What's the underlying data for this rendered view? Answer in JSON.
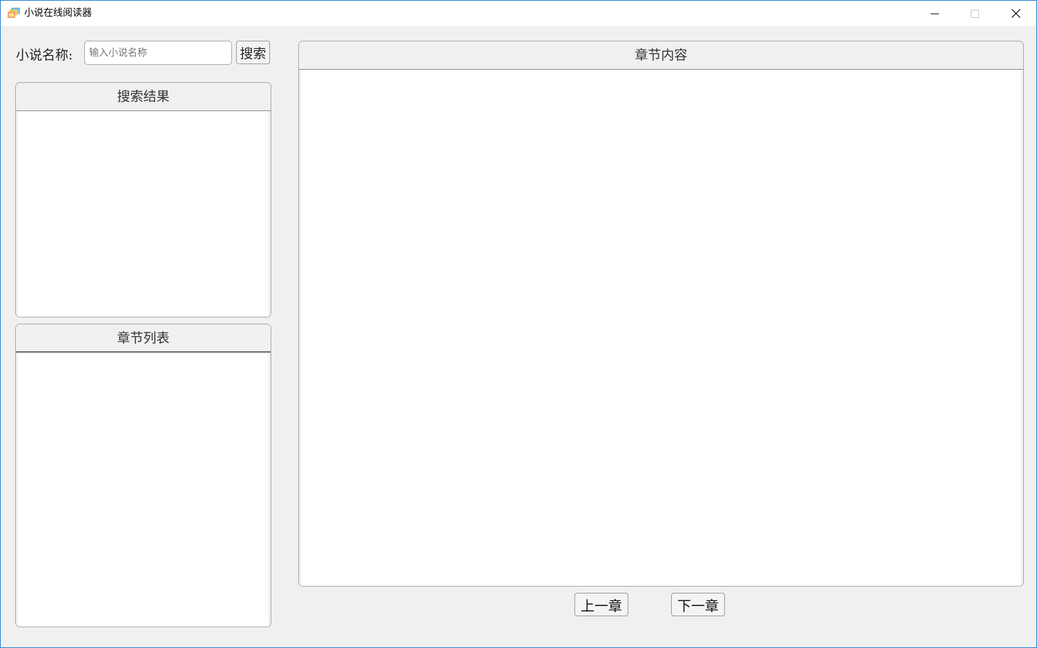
{
  "window": {
    "title": "小说在线阅读器"
  },
  "search": {
    "label": "小说名称:",
    "input_value": "",
    "placeholder": "输入小说名称",
    "button_label": "搜索"
  },
  "panels": {
    "search_results_title": "搜索结果",
    "chapter_list_title": "章节列表",
    "chapter_content_title": "章节内容"
  },
  "navigation": {
    "prev_label": "上一章",
    "next_label": "下一章"
  },
  "icons": {
    "app": "app-icon",
    "minimize": "minimize-icon",
    "maximize": "maximize-icon",
    "close": "close-icon"
  },
  "colors": {
    "window_border": "#2b7fd4",
    "background": "#f0f0f0",
    "panel_body": "#ffffff"
  }
}
